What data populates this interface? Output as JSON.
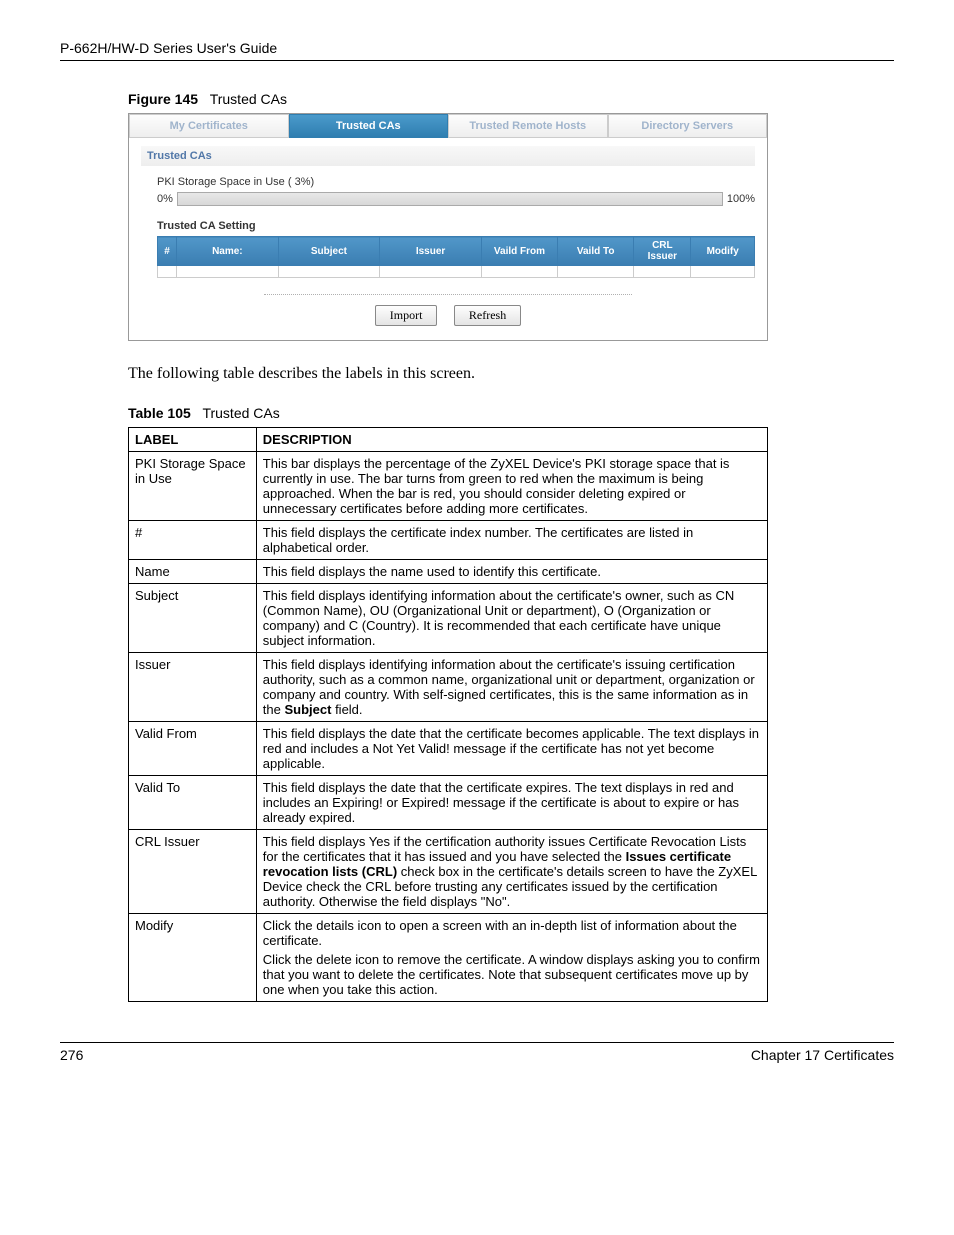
{
  "header": {
    "guide_title": "P-662H/HW-D Series User's Guide"
  },
  "figure": {
    "num": "Figure 145",
    "title": "Trusted CAs"
  },
  "screenshot": {
    "tabs": [
      "My Certificates",
      "Trusted CAs",
      "Trusted Remote Hosts",
      "Directory Servers"
    ],
    "active_tab_index": 1,
    "section_title": "Trusted CAs",
    "storage_label": "PKI Storage Space in Use ( 3%)",
    "bar_min": "0%",
    "bar_max": "100%",
    "setting_title": "Trusted CA Setting",
    "columns": [
      "#",
      "Name:",
      "Subject",
      "Issuer",
      "Vaild From",
      "Vaild To",
      "CRL Issuer",
      "Modify"
    ],
    "buttons": {
      "import": "Import",
      "refresh": "Refresh"
    }
  },
  "paragraph": "The following table describes the labels in this screen.",
  "tablecap": {
    "num": "Table 105",
    "title": "Trusted CAs"
  },
  "tableheaders": {
    "label": "LABEL",
    "desc": "DESCRIPTION"
  },
  "rows": [
    {
      "label": "PKI Storage Space in Use",
      "desc": "This bar displays the percentage of the ZyXEL Device's PKI storage space that is currently in use. The bar turns from green to red when the maximum is being approached. When the bar is red, you should consider deleting expired or unnecessary certificates before adding more certificates."
    },
    {
      "label": "#",
      "desc": "This field displays the certificate index number. The certificates are listed in alphabetical order."
    },
    {
      "label": "Name",
      "desc": "This field displays the name used to identify this certificate."
    },
    {
      "label": "Subject",
      "desc": "This field displays identifying information about the certificate's owner, such as CN (Common Name), OU (Organizational Unit or department), O (Organization or company) and C (Country). It is recommended that each certificate have unique subject information."
    },
    {
      "label": "Issuer",
      "desc_pre": "This field displays identifying information about the certificate's issuing certification authority, such as a common name, organizational unit or department, organization or company and country. With self-signed certificates, this is the same information as in the ",
      "bold": "Subject",
      "desc_post": " field."
    },
    {
      "label": "Valid From",
      "desc": "This field displays the date that the certificate becomes applicable. The text displays in red and includes a Not Yet Valid! message if the certificate has not yet become applicable."
    },
    {
      "label": "Valid To",
      "desc": "This field displays the date that the certificate expires. The text displays in red and includes an Expiring! or Expired! message if the certificate is about to expire or has already expired."
    },
    {
      "label": "CRL Issuer",
      "desc_pre": "This field displays Yes if the certification authority issues Certificate Revocation Lists for the certificates that it has issued and you have selected the ",
      "bold": "Issues certificate revocation lists (CRL)",
      "desc_post": " check box in the certificate's details screen to have the ZyXEL Device check the CRL before trusting any certificates issued by the certification authority. Otherwise the field displays \"No\"."
    },
    {
      "label": "Modify",
      "p1": "Click the details icon to open a screen with an in-depth list of information about the certificate.",
      "p2": "Click the delete icon to remove the certificate. A window displays asking you to confirm that you want to delete the certificates. Note that subsequent certificates move up by one when you take this action."
    }
  ],
  "footer": {
    "page": "276",
    "chapter": "Chapter 17 Certificates"
  }
}
